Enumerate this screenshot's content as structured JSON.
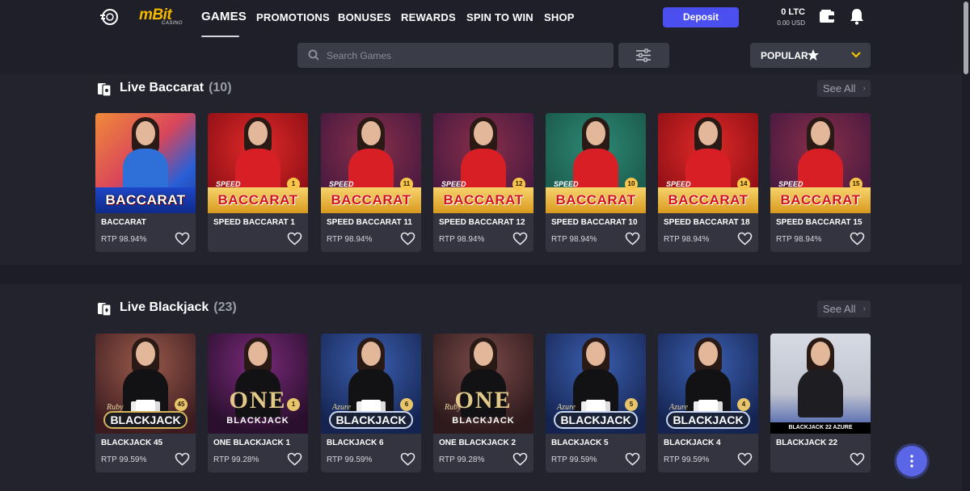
{
  "header": {
    "logo_text": "mBit",
    "logo_sub": "CASINO",
    "nav": [
      {
        "label": "GAMES",
        "active": true
      },
      {
        "label": "PROMOTIONS",
        "active": false
      },
      {
        "label": "BONUSES",
        "active": false
      },
      {
        "label": "REWARDS",
        "active": false
      },
      {
        "label": "SPIN TO WIN",
        "active": false
      },
      {
        "label": "SHOP",
        "active": false
      }
    ],
    "deposit_label": "Deposit",
    "balance": "0 LTC",
    "balance_usd": "0.00 USD",
    "icons": {
      "chip": "poker-chip-icon",
      "wallet": "wallet-icon",
      "bell": "bell-icon"
    }
  },
  "search": {
    "placeholder": "Search Games",
    "value": "",
    "filter_icon": "sliders-icon",
    "sort_label": "POPULAR",
    "sort_icon": "star-icon"
  },
  "colors": {
    "accent": "#4b4ff0",
    "gold": "#f5b800",
    "sort_chevron": "#f5c400",
    "fab": "#5a66e6"
  },
  "sections": [
    {
      "title": "Live Baccarat",
      "count": "(10)",
      "see_all": "See All",
      "games": [
        {
          "name": "BACCARAT",
          "rtp": "RTP 98.94%"
        },
        {
          "name": "SPEED BACCARAT 1",
          "rtp": ""
        },
        {
          "name": "SPEED BACCARAT 11",
          "rtp": "RTP 98.94%"
        },
        {
          "name": "SPEED BACCARAT 12",
          "rtp": "RTP 98.94%"
        },
        {
          "name": "SPEED BACCARAT 10",
          "rtp": "RTP 98.94%"
        },
        {
          "name": "SPEED BACCARAT 18",
          "rtp": "RTP 98.94%"
        },
        {
          "name": "SPEED BACCARAT 15",
          "rtp": "RTP 98.94%"
        }
      ],
      "art": {
        "brand": "BACCARAT",
        "speed": "SPEED",
        "numbers": [
          "",
          "1",
          "11",
          "12",
          "10",
          "14",
          "15"
        ]
      }
    },
    {
      "title": "Live Blackjack",
      "count": "(23)",
      "see_all": "See All",
      "games": [
        {
          "name": "BLACKJACK 45",
          "rtp": "RTP 99.59%"
        },
        {
          "name": "ONE BLACKJACK 1",
          "rtp": "RTP 99.28%"
        },
        {
          "name": "BLACKJACK 6",
          "rtp": "RTP 99.59%"
        },
        {
          "name": "ONE BLACKJACK 2",
          "rtp": "RTP 99.28%"
        },
        {
          "name": "BLACKJACK 5",
          "rtp": "RTP 99.59%"
        },
        {
          "name": "BLACKJACK 4",
          "rtp": "RTP 99.59%"
        },
        {
          "name": "BLACKJACK 22",
          "rtp": ""
        }
      ],
      "art": {
        "brand": "BLACKJACK",
        "one": "ONE",
        "ruby": "Ruby",
        "azure": "Azure",
        "numbers": [
          "45",
          "1",
          "6",
          "",
          "5",
          "4",
          ""
        ],
        "caption_22": "BLACKJACK 22 AZURE"
      }
    }
  ]
}
